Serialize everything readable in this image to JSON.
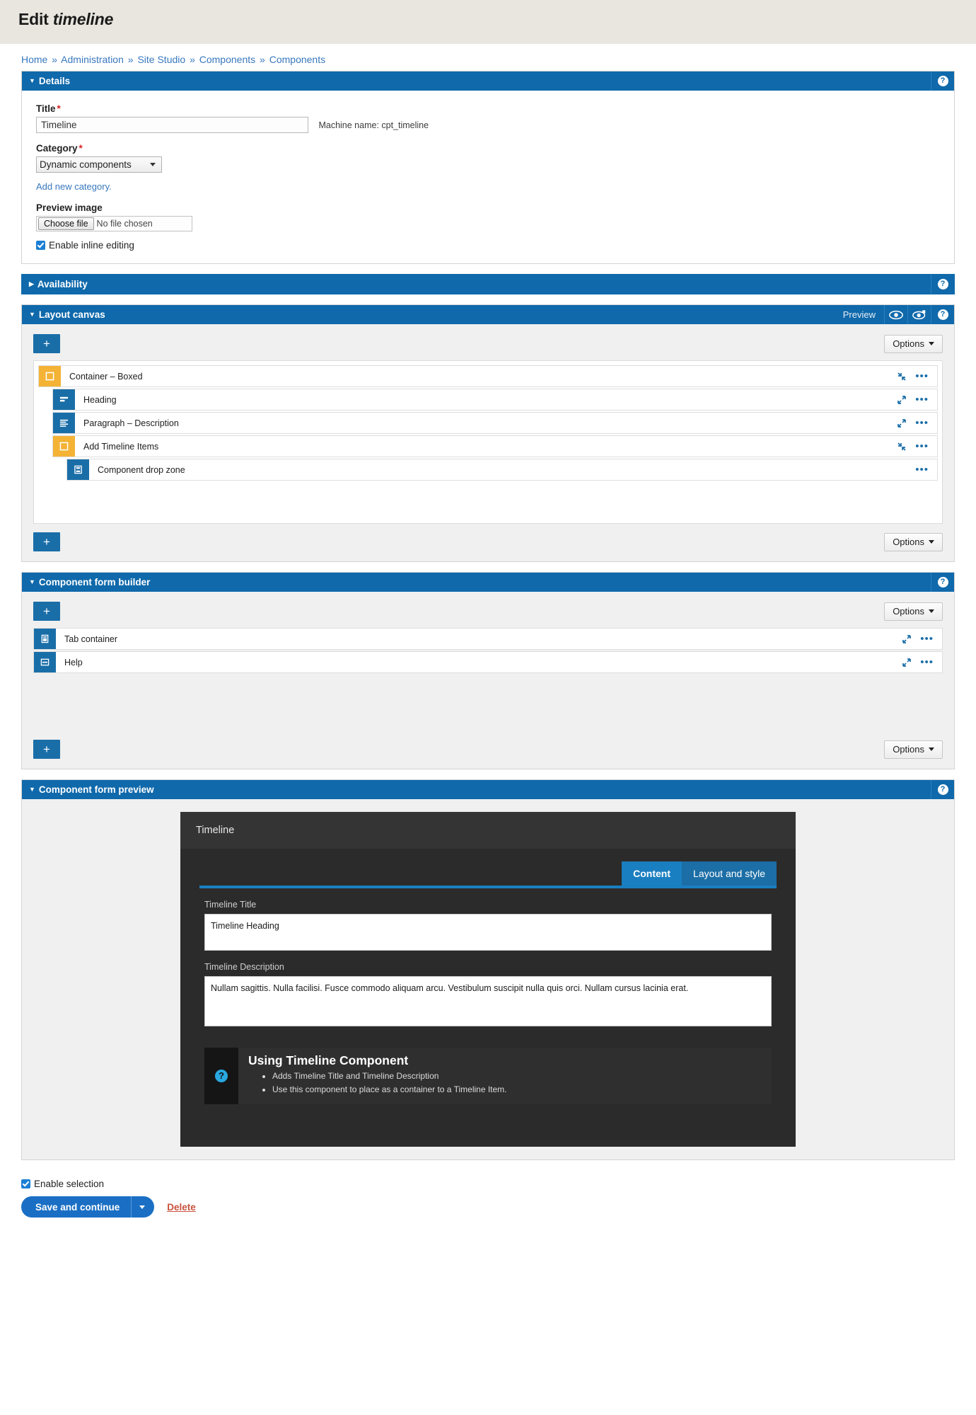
{
  "header": {
    "title_prefix": "Edit",
    "title_emphasis": "timeline"
  },
  "breadcrumb": {
    "items": [
      "Home",
      "Administration",
      "Site Studio",
      "Components",
      "Components"
    ],
    "separator": "»"
  },
  "details": {
    "section_title": "Details",
    "help_icon": "question-mark-icon",
    "title_label": "Title",
    "title_value": "Timeline",
    "machine_name": "Machine name: cpt_timeline",
    "category_label": "Category",
    "category_value": "Dynamic components",
    "add_category_link": "Add new category.",
    "preview_image_label": "Preview image",
    "choose_file_button": "Choose file",
    "file_status": "No file chosen",
    "inline_editing_label": "Enable inline editing",
    "inline_editing_checked": true,
    "required_marker": "*"
  },
  "availability": {
    "section_title": "Availability"
  },
  "layout_canvas": {
    "section_title": "Layout canvas",
    "preview_label": "Preview",
    "add_button": "+",
    "options_button": "Options",
    "nodes": [
      {
        "label": "Container – Boxed",
        "icon": "container-icon",
        "color": "amber",
        "depth": 0,
        "collapse": "collapse-arrows-icon",
        "menu": "ellipsis-icon"
      },
      {
        "label": "Heading",
        "icon": "heading-icon",
        "color": "blue",
        "depth": 1,
        "collapse": "expand-arrows-icon",
        "menu": "ellipsis-icon"
      },
      {
        "label": "Paragraph – Description",
        "icon": "paragraph-icon",
        "color": "blue",
        "depth": 1,
        "collapse": "expand-arrows-icon",
        "menu": "ellipsis-icon"
      },
      {
        "label": "Add Timeline Items",
        "icon": "container-icon",
        "color": "amber",
        "depth": 1,
        "collapse": "collapse-arrows-icon",
        "menu": "ellipsis-icon"
      },
      {
        "label": "Component drop zone",
        "icon": "drop-zone-icon",
        "color": "blue",
        "depth": 2,
        "collapse": "",
        "menu": "ellipsis-icon"
      }
    ]
  },
  "form_builder": {
    "section_title": "Component form builder",
    "add_button": "+",
    "options_button": "Options",
    "nodes": [
      {
        "label": "Tab container",
        "icon": "tab-container-icon",
        "collapse": "expand-arrows-icon",
        "menu": "ellipsis-icon"
      },
      {
        "label": "Help",
        "icon": "help-field-icon",
        "collapse": "expand-arrows-icon",
        "menu": "ellipsis-icon"
      }
    ]
  },
  "form_preview": {
    "section_title": "Component form preview",
    "modal_title": "Timeline",
    "tabs": [
      {
        "label": "Content",
        "active": true
      },
      {
        "label": "Layout and style",
        "active": false
      }
    ],
    "fields": [
      {
        "label": "Timeline Title",
        "value": "Timeline Heading"
      },
      {
        "label": "Timeline Description",
        "value": "Nullam sagittis. Nulla facilisi. Fusce commodo aliquam arcu. Vestibulum suscipit nulla quis orci. Nullam cursus lacinia erat."
      }
    ],
    "help": {
      "title": "Using Timeline Component",
      "bullets": [
        "Adds Timeline Title and Timeline Description",
        "Use this component to place as a container to a Timeline Item."
      ]
    }
  },
  "footer": {
    "enable_selection_label": "Enable selection",
    "enable_selection_checked": true,
    "save_button": "Save and continue",
    "delete_link": "Delete"
  },
  "colors": {
    "panel_header": "#0f69ab",
    "accent_blue": "#1a6ea8",
    "amber": "#f4b335",
    "link": "#3878be",
    "danger": "#c8523c",
    "required": "#d72222"
  }
}
